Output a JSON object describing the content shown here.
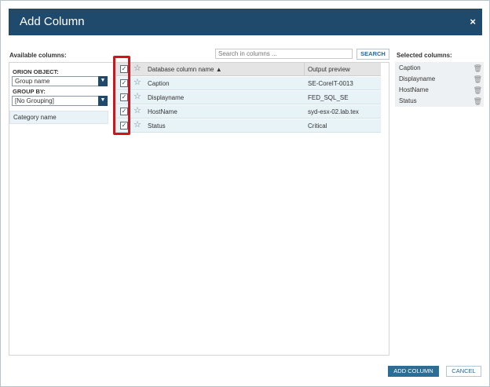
{
  "dialog": {
    "title": "Add Column",
    "close_label": "×"
  },
  "available": {
    "label": "Available columns:",
    "orion_object_label": "ORION OBJECT:",
    "orion_object_value": "Group name",
    "group_by_label": "GROUP BY:",
    "group_by_value": "[No Grouping]",
    "category": "Category name"
  },
  "search": {
    "placeholder": "Search in columns ...",
    "button": "SEARCH"
  },
  "grid": {
    "header": {
      "name": "Database column name ▲",
      "preview": "Output preview"
    },
    "rows": [
      {
        "name": "Caption",
        "preview": "SE-CoreIT-0013",
        "checked": true
      },
      {
        "name": "Displayname",
        "preview": "FED_SQL_SE",
        "checked": true
      },
      {
        "name": "HostName",
        "preview": "syd-esx-02.lab.tex",
        "checked": true
      },
      {
        "name": "Status",
        "preview": "Critical",
        "checked": true
      }
    ]
  },
  "selected": {
    "label": "Selected columns:",
    "items": [
      "Caption",
      "Displayname",
      "HostName",
      "Status"
    ]
  },
  "footer": {
    "add_label": "ADD COLUMN",
    "cancel_label": "CANCEL"
  },
  "icons": {
    "star": "☆",
    "check": "✓",
    "trash": "🗑",
    "chevron": "⌄"
  },
  "colors": {
    "titlebar": "#1f4a6b",
    "highlight": "#d0141b",
    "primary_button": "#2a6d97"
  }
}
